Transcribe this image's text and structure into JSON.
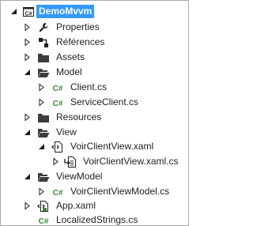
{
  "colors": {
    "selection": "#3399ff",
    "folder": "#3d3d3d",
    "csharp": "#388a34",
    "xaml": "#1e1e1e"
  },
  "tree": {
    "project": "DemoMvvm",
    "properties": "Properties",
    "references": "Références",
    "assets": "Assets",
    "model": "Model",
    "client_cs": "Client.cs",
    "service_client_cs": "ServiceClient.cs",
    "resources": "Resources",
    "view": "View",
    "voir_client_view_xaml": "VoirClientView.xaml",
    "voir_client_view_xaml_cs": "VoirClientView.xaml.cs",
    "viewmodel": "ViewModel",
    "voir_client_viewmodel_cs": "VoirClientViewModel.cs",
    "app_xaml": "App.xaml",
    "localized_strings_cs": "LocalizedStrings.cs"
  },
  "icons": {
    "csharp_glyph": "C#"
  }
}
